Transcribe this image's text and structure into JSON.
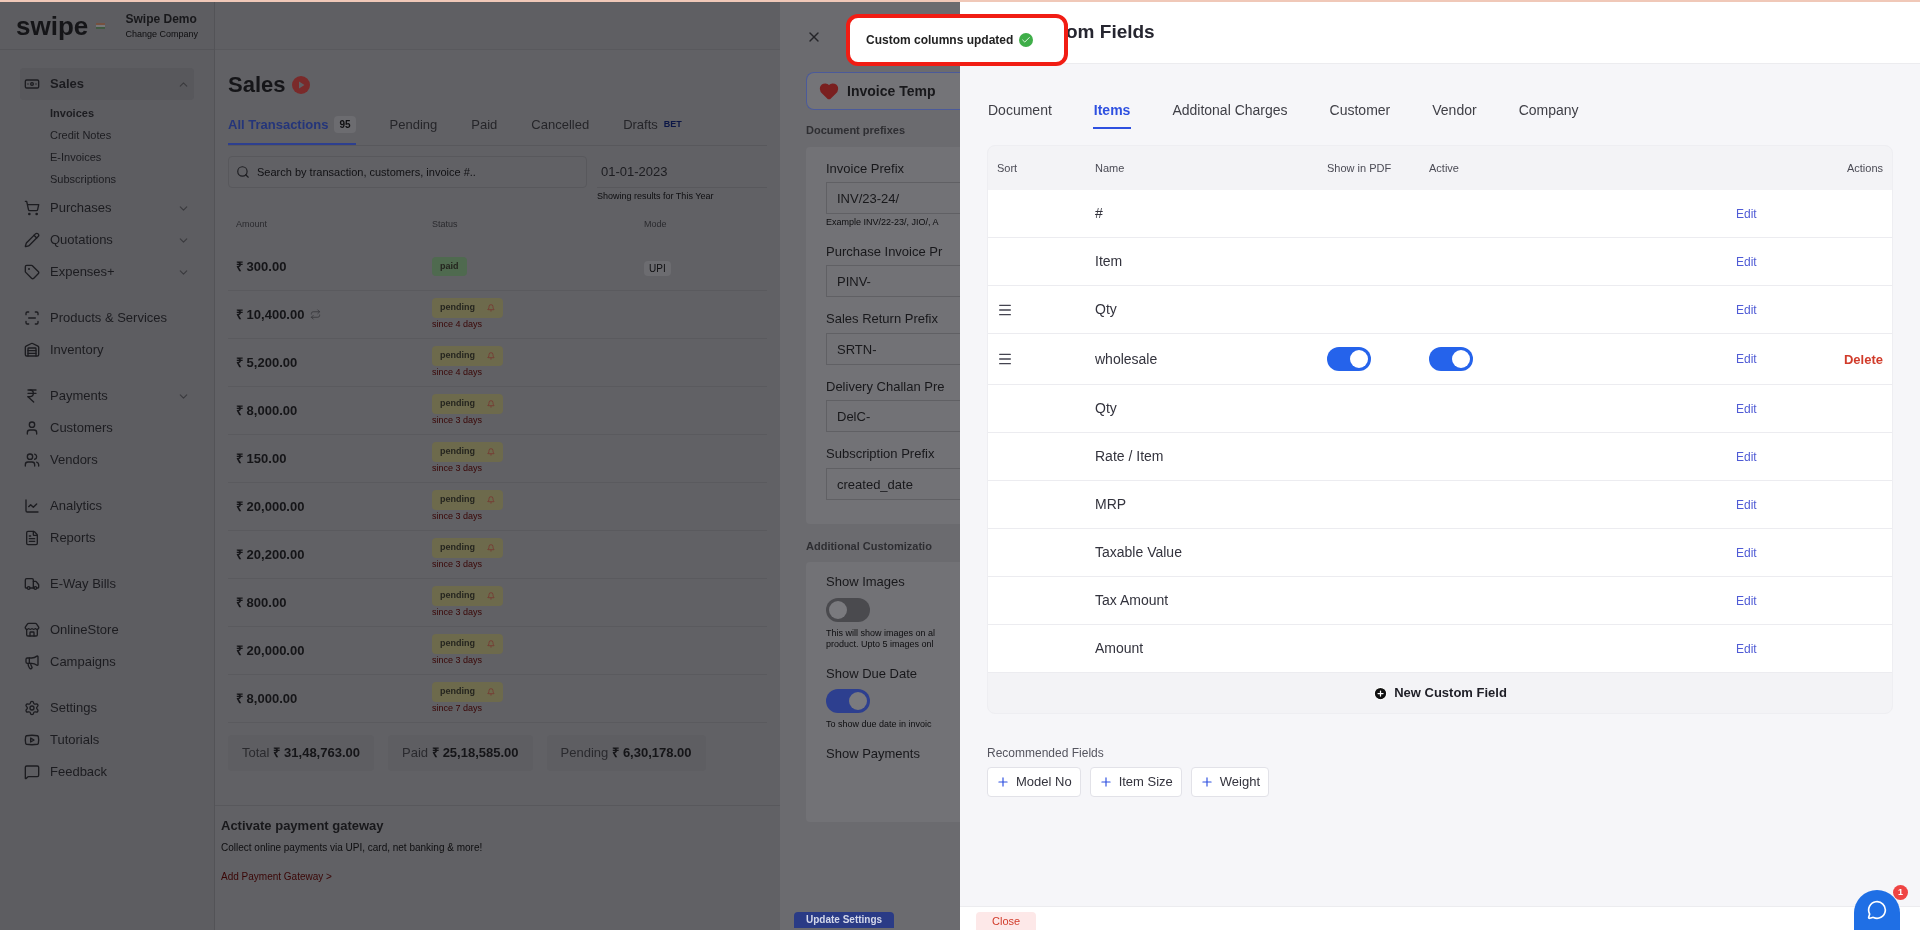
{
  "sidebar": {
    "logo": "swipe",
    "company": "Swipe Demo",
    "company_hint": "Change Company",
    "items": [
      {
        "label": "Sales",
        "kind": "group",
        "expanded": true,
        "children": [
          {
            "label": "Invoices",
            "selected": true
          },
          {
            "label": "Credit Notes",
            "selected": false
          },
          {
            "label": "E-Invoices",
            "selected": false
          },
          {
            "label": "Subscriptions",
            "selected": false
          }
        ]
      },
      {
        "label": "Purchases",
        "kind": "group",
        "expanded": false
      },
      {
        "label": "Quotations",
        "kind": "group",
        "expanded": false
      },
      {
        "label": "Expenses+",
        "kind": "group",
        "expanded": false
      },
      {
        "label": "Products & Services",
        "kind": "link"
      },
      {
        "label": "Inventory",
        "kind": "link"
      },
      {
        "label": "Payments",
        "kind": "group",
        "expanded": false
      },
      {
        "label": "Customers",
        "kind": "link"
      },
      {
        "label": "Vendors",
        "kind": "link"
      },
      {
        "label": "Analytics",
        "kind": "link"
      },
      {
        "label": "Reports",
        "kind": "link"
      },
      {
        "label": "E-Way Bills",
        "kind": "link"
      },
      {
        "label": "OnlineStore",
        "kind": "link"
      },
      {
        "label": "Campaigns",
        "kind": "link"
      },
      {
        "label": "Settings",
        "kind": "link"
      },
      {
        "label": "Tutorials",
        "kind": "link"
      },
      {
        "label": "Feedback",
        "kind": "link"
      }
    ]
  },
  "sales": {
    "title": "Sales",
    "tabs": [
      {
        "label": "All Transactions",
        "count": "95",
        "selected": true
      },
      {
        "label": "Pending",
        "selected": false
      },
      {
        "label": "Paid",
        "selected": false
      },
      {
        "label": "Cancelled",
        "selected": false
      },
      {
        "label": "Drafts",
        "tag": "BET",
        "selected": false
      }
    ],
    "search": {
      "placeholder": "Search by transaction, customers, invoice #.."
    },
    "date": "01-01-2023",
    "date_hint": "Showing results for This Year",
    "columns": [
      "Amount",
      "Status",
      "Mode"
    ],
    "rows": [
      {
        "amount": "₹ 300.00",
        "status": "paid",
        "mode": "UPI"
      },
      {
        "amount": "₹ 10,400.00",
        "recurring": true,
        "status": "pending",
        "since": "since 4 days"
      },
      {
        "amount": "₹ 5,200.00",
        "status": "pending",
        "since": "since 4 days"
      },
      {
        "amount": "₹ 8,000.00",
        "status": "pending",
        "since": "since 3 days"
      },
      {
        "amount": "₹ 150.00",
        "status": "pending",
        "since": "since 3 days"
      },
      {
        "amount": "₹ 20,000.00",
        "status": "pending",
        "since": "since 3 days"
      },
      {
        "amount": "₹ 20,200.00",
        "status": "pending",
        "since": "since 3 days"
      },
      {
        "amount": "₹ 800.00",
        "status": "pending",
        "since": "since 3 days"
      },
      {
        "amount": "₹ 20,000.00",
        "status": "pending",
        "since": "since 3 days"
      },
      {
        "amount": "₹ 8,000.00",
        "status": "pending",
        "since": "since 7 days"
      }
    ],
    "totals": [
      {
        "label": "Total",
        "value": "₹ 31,48,763.00"
      },
      {
        "label": "Paid",
        "value": "₹ 25,18,585.00"
      },
      {
        "label": "Pending",
        "value": "₹ 6,30,178.00"
      }
    ],
    "gateway": {
      "title": "Activate payment gateway",
      "text": "Collect online payments via UPI, card, net banking & more!",
      "link": "Add Payment Gateway >"
    }
  },
  "settings_drawer": {
    "template_button": "Invoice Temp",
    "prefix_heading": "Document prefixes",
    "prefixes": [
      {
        "label": "Invoice Prefix",
        "value": "INV/23-24/",
        "hint": "Example INV/22-23/, JIO/, A"
      },
      {
        "label": "Purchase Invoice Pr",
        "value": "PINV-"
      },
      {
        "label": "Sales Return Prefix",
        "value": "SRTN-"
      },
      {
        "label": "Delivery Challan Pre",
        "value": "DelC-"
      },
      {
        "label": "Subscription Prefix",
        "value": "created_date"
      }
    ],
    "custom_heading": "Additional Customizatio",
    "options": [
      {
        "label": "Show Images",
        "kind": "toggle",
        "on": false,
        "hint": "This will show images on al product. Upto 5 images onl"
      },
      {
        "label": "Show Due Date",
        "kind": "toggle",
        "on": true,
        "hint": "To show due date in invoic"
      },
      {
        "label": "Show Payments",
        "kind": "label"
      }
    ],
    "save_button": "Update Settings"
  },
  "toast": {
    "text": "Custom columns updated"
  },
  "custom_fields": {
    "title": "om Fields",
    "tabs": [
      {
        "label": "Document",
        "selected": false
      },
      {
        "label": "Items",
        "selected": true
      },
      {
        "label": "Additonal Charges",
        "selected": false
      },
      {
        "label": "Customer",
        "selected": false
      },
      {
        "label": "Vendor",
        "selected": false
      },
      {
        "label": "Company",
        "selected": false
      }
    ],
    "columns": [
      "Sort",
      "Name",
      "Show in PDF",
      "Active",
      "Actions"
    ],
    "rows": [
      {
        "name": "#",
        "kind": "default",
        "draggable": false,
        "edit": "Edit"
      },
      {
        "name": "Item",
        "kind": "default",
        "draggable": false,
        "edit": "Edit"
      },
      {
        "name": "Qty",
        "kind": "default",
        "draggable": true,
        "edit": "Edit"
      },
      {
        "name": "wholesale",
        "kind": "custom",
        "draggable": true,
        "show_in_pdf": true,
        "active": true,
        "edit": "Edit",
        "delete": "Delete"
      },
      {
        "name": "Qty",
        "kind": "default",
        "draggable": false,
        "edit": "Edit"
      },
      {
        "name": "Rate / Item",
        "kind": "default",
        "draggable": false,
        "edit": "Edit"
      },
      {
        "name": "MRP",
        "kind": "default",
        "draggable": false,
        "edit": "Edit"
      },
      {
        "name": "Taxable Value",
        "kind": "default",
        "draggable": false,
        "edit": "Edit"
      },
      {
        "name": "Tax Amount",
        "kind": "default",
        "draggable": false,
        "edit": "Edit"
      },
      {
        "name": "Amount",
        "kind": "default",
        "draggable": false,
        "edit": "Edit"
      }
    ],
    "new_field": "New Custom Field",
    "recommended_heading": "Recommended Fields",
    "recommended": [
      "Model No",
      "Item Size",
      "Weight"
    ],
    "close_button": "Close"
  },
  "chat": {
    "badge": "1"
  }
}
